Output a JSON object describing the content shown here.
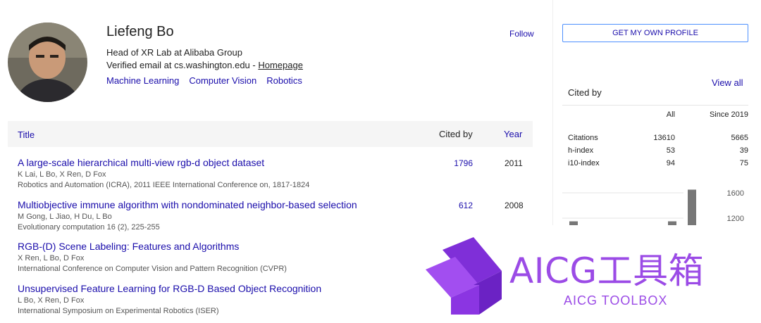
{
  "profile": {
    "name": "Liefeng Bo",
    "affiliation": "Head of XR Lab at Alibaba Group",
    "email_prefix": "Verified email at cs.washington.edu - ",
    "homepage": "Homepage",
    "interests": [
      "Machine Learning",
      "Computer Vision",
      "Robotics"
    ],
    "follow": "Follow"
  },
  "sidebar": {
    "get_profile": "GET MY OWN PROFILE",
    "cited_by": "Cited by",
    "view_all": "View all",
    "stats_headers": [
      "All",
      "Since 2019"
    ],
    "stats": [
      {
        "label": "Citations",
        "all": "13610",
        "since": "5665"
      },
      {
        "label": "h-index",
        "all": "53",
        "since": "39"
      },
      {
        "label": "i10-index",
        "all": "94",
        "since": "75"
      }
    ]
  },
  "chart_data": {
    "type": "bar",
    "y_ticks": [
      "1600",
      "1200"
    ],
    "values": [
      1150,
      1150,
      1650
    ]
  },
  "table": {
    "headers": {
      "title": "Title",
      "cited_by": "Cited by",
      "year": "Year"
    },
    "articles": [
      {
        "title": "A large-scale hierarchical multi-view rgb-d object dataset",
        "authors": "K Lai, L Bo, X Ren, D Fox",
        "venue": "Robotics and Automation (ICRA), 2011 IEEE International Conference on, 1817-1824",
        "cited": "1796",
        "year": "2011"
      },
      {
        "title": "Multiobjective immune algorithm with nondominated neighbor-based selection",
        "authors": "M Gong, L Jiao, H Du, L Bo",
        "venue": "Evolutionary computation 16 (2), 225-255",
        "cited": "612",
        "year": "2008"
      },
      {
        "title": "RGB-(D) Scene Labeling: Features and Algorithms",
        "authors": "X Ren, L Bo, D Fox",
        "venue": "International Conference on Computer Vision and Pattern Recognition (CVPR)",
        "cited": "",
        "year": ""
      },
      {
        "title": "Unsupervised Feature Learning for RGB-D Based Object Recognition",
        "authors": "L Bo, X Ren, D Fox",
        "venue": "International Symposium on Experimental Robotics (ISER)",
        "cited": "",
        "year": ""
      }
    ]
  },
  "watermark": {
    "title": "AICG工具箱",
    "subtitle": "AICG TOOLBOX",
    "color": "#9b4be6"
  }
}
